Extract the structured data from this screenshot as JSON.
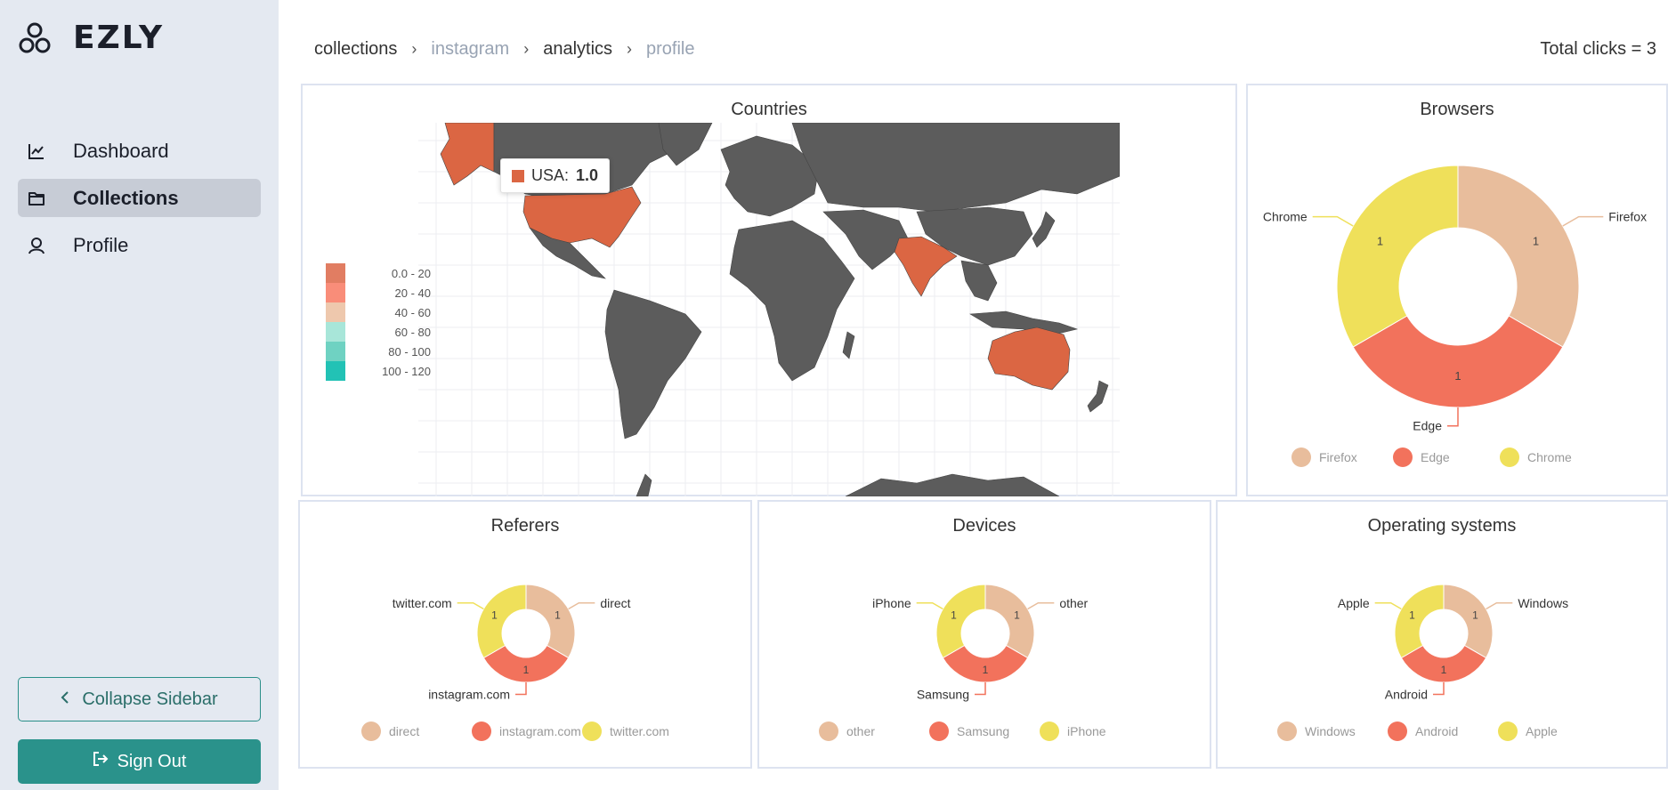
{
  "app": {
    "name": "EZLY"
  },
  "sidebar": {
    "items": [
      {
        "label": "Dashboard",
        "icon": "chart-line-icon",
        "active": false
      },
      {
        "label": "Collections",
        "icon": "folder-icon",
        "active": true
      },
      {
        "label": "Profile",
        "icon": "user-icon",
        "active": false
      }
    ],
    "collapse_label": "Collapse Sidebar",
    "signout_label": "Sign Out"
  },
  "breadcrumb": [
    "collections",
    "instagram",
    "analytics",
    "profile"
  ],
  "total_clicks": "Total clicks = 3",
  "colors": {
    "accent": "#2a928b",
    "firefox": "#e8bd9c",
    "edge": "#f2725c",
    "chrome": "#efe05a",
    "map_land": "#5c5c5c",
    "map_highlight": "#db6643"
  },
  "countries": {
    "title": "Countries",
    "tooltip": {
      "country": "USA:",
      "value": "1.0"
    },
    "highlighted": [
      "USA",
      "India",
      "Australia"
    ],
    "legend": [
      {
        "label": "0.0 - 20",
        "color": "#e17d62"
      },
      {
        "label": "20 - 40",
        "color": "#f98d79"
      },
      {
        "label": "40 - 60",
        "color": "#eec8ad"
      },
      {
        "label": "60 - 80",
        "color": "#a8e6d9"
      },
      {
        "label": "80 - 100",
        "color": "#6fd2c2"
      },
      {
        "label": "100 - 120",
        "color": "#22c2b5"
      }
    ]
  },
  "chart_data": [
    {
      "type": "pie",
      "title": "Browsers",
      "categories": [
        "Firefox",
        "Edge",
        "Chrome"
      ],
      "values": [
        1,
        1,
        1
      ],
      "colors": [
        "#e8bd9c",
        "#f2725c",
        "#efe05a"
      ]
    },
    {
      "type": "pie",
      "title": "Referers",
      "categories": [
        "direct",
        "instagram.com",
        "twitter.com"
      ],
      "values": [
        1,
        1,
        1
      ],
      "colors": [
        "#e8bd9c",
        "#f2725c",
        "#efe05a"
      ]
    },
    {
      "type": "pie",
      "title": "Devices",
      "categories": [
        "other",
        "Samsung",
        "iPhone"
      ],
      "values": [
        1,
        1,
        1
      ],
      "colors": [
        "#e8bd9c",
        "#f2725c",
        "#efe05a"
      ]
    },
    {
      "type": "pie",
      "title": "Operating systems",
      "categories": [
        "Windows",
        "Android",
        "Apple"
      ],
      "values": [
        1,
        1,
        1
      ],
      "colors": [
        "#e8bd9c",
        "#f2725c",
        "#efe05a"
      ]
    }
  ]
}
